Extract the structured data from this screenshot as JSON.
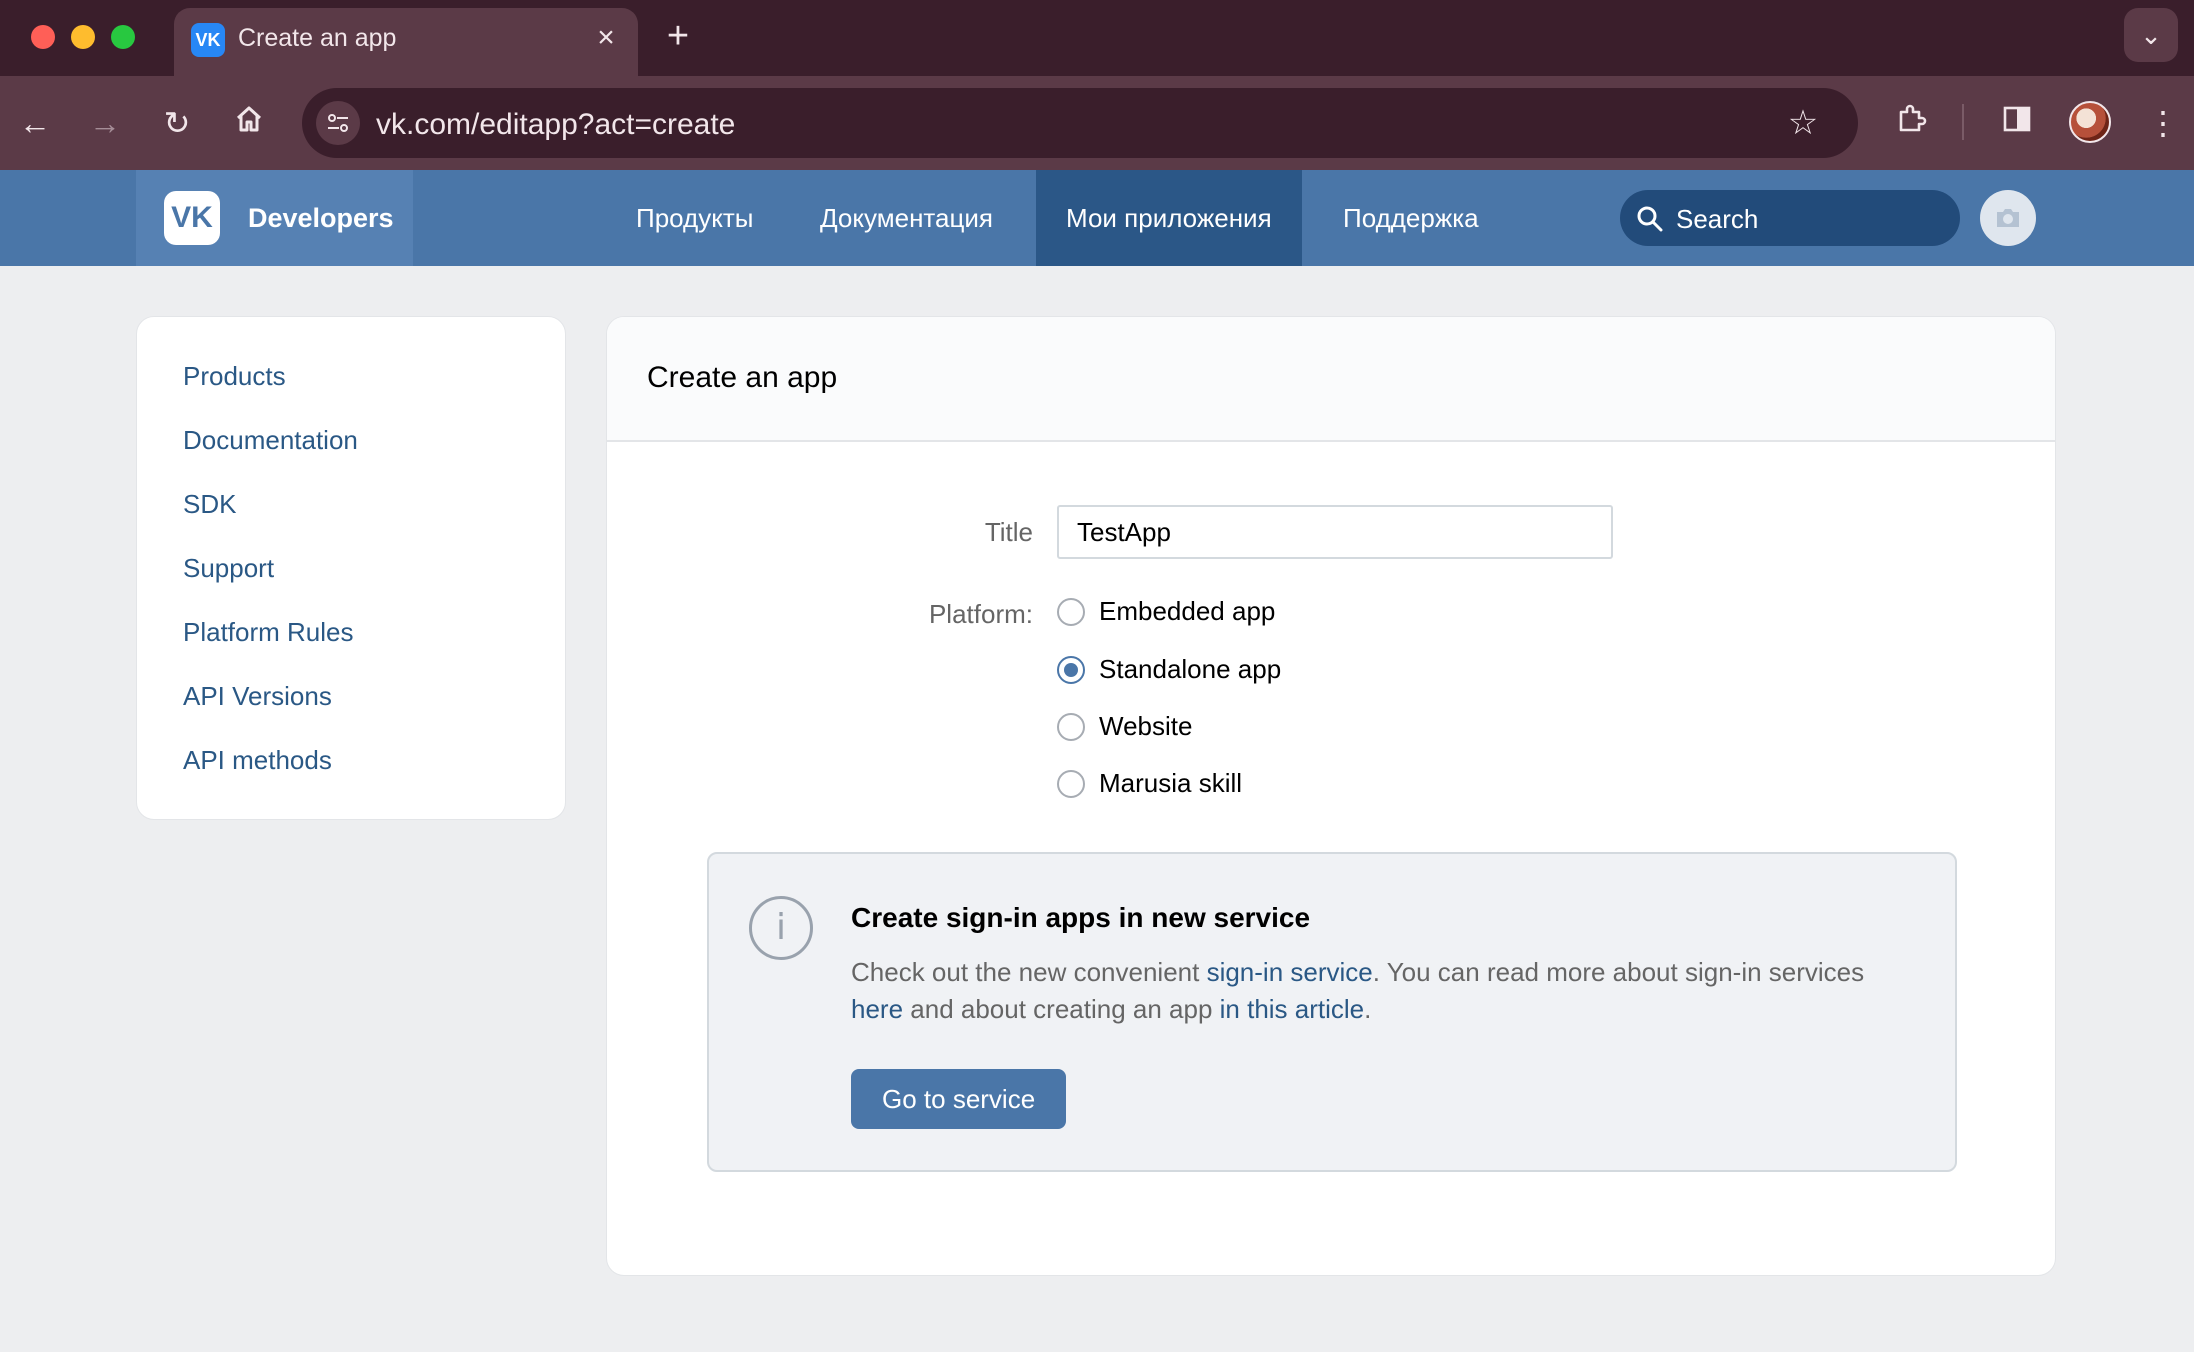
{
  "browser": {
    "tab_title": "Create an app",
    "tab_favicon_text": "VK",
    "new_tab_symbol": "+",
    "url": "vk.com/editapp?act=create"
  },
  "header": {
    "brand_logo_text": "VK",
    "brand_text": "Developers",
    "nav": [
      {
        "label": "Продукты",
        "active": false
      },
      {
        "label": "Документация",
        "active": false
      },
      {
        "label": "Мои приложения",
        "active": true
      },
      {
        "label": "Поддержка",
        "active": false
      }
    ],
    "search_placeholder": "Search"
  },
  "sidebar": {
    "items": [
      {
        "label": "Products"
      },
      {
        "label": "Documentation"
      },
      {
        "label": "SDK"
      },
      {
        "label": "Support"
      },
      {
        "label": "Platform Rules"
      },
      {
        "label": "API Versions"
      },
      {
        "label": "API methods"
      }
    ]
  },
  "form": {
    "heading": "Create an app",
    "title_label": "Title",
    "title_value": "TestApp",
    "platform_label": "Platform:",
    "platforms": [
      {
        "label": "Embedded app",
        "checked": false
      },
      {
        "label": "Standalone app",
        "checked": true
      },
      {
        "label": "Website",
        "checked": false
      },
      {
        "label": "Marusia skill",
        "checked": false
      }
    ]
  },
  "info": {
    "icon": "i",
    "title": "Create sign-in apps in new service",
    "text_1": "Check out the new convenient ",
    "link_1": "sign-in service",
    "text_2": ". You can read more about sign-in services ",
    "link_2": "here",
    "text_3": " and about creating an app ",
    "link_3": "in this article",
    "text_4": ".",
    "button": "Go to service"
  },
  "colors": {
    "accent": "#4a76a8",
    "link": "#2a5885",
    "browser_frame": "#3a1e2b"
  }
}
